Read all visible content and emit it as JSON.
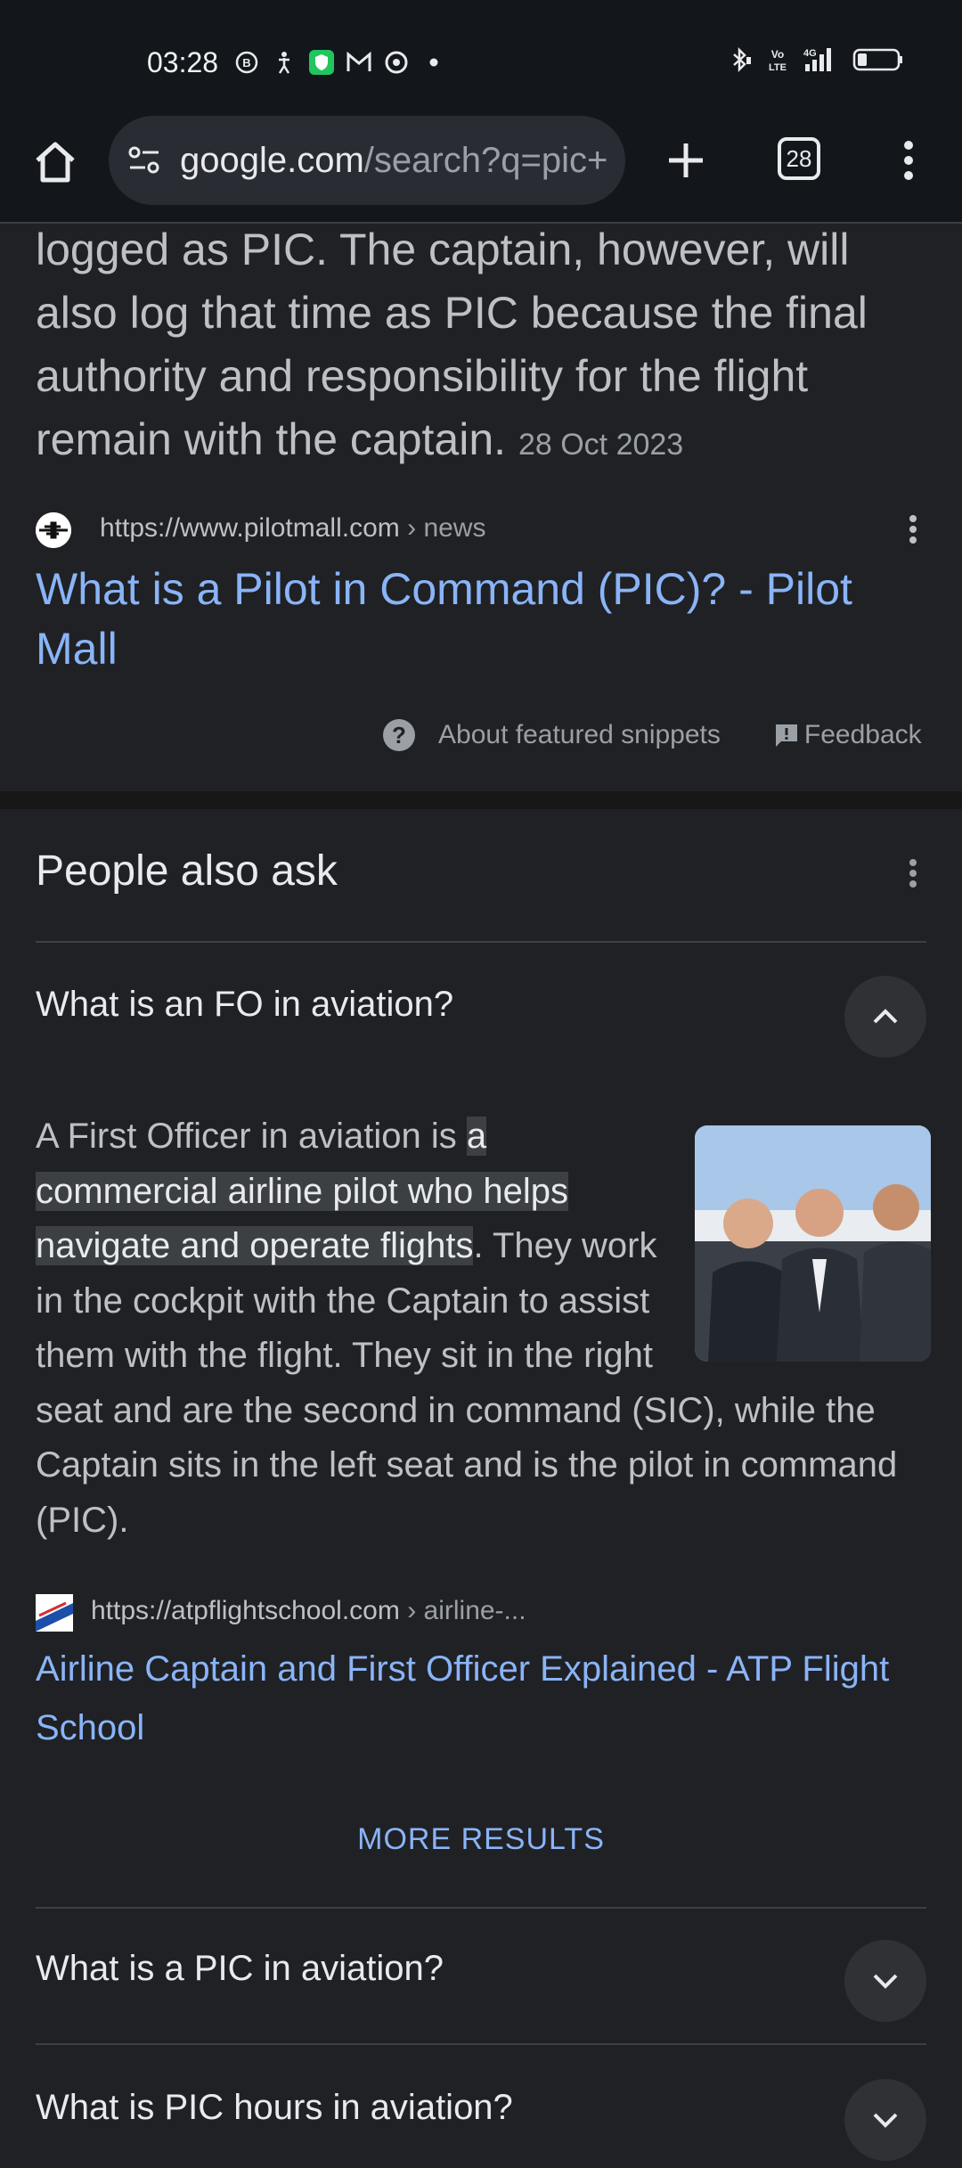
{
  "status_bar": {
    "time": "03:28",
    "left_icons": [
      "b-badge-icon",
      "runner-icon",
      "shield-app-icon",
      "gmail-icon",
      "chrome-icon",
      "dot-icon"
    ],
    "right_icons": [
      "bluetooth-icon",
      "volte-icon",
      "signal-4g-icon",
      "battery-icon"
    ],
    "volte_label": "Vo LTE",
    "network_label": "4G"
  },
  "toolbar": {
    "url_host": "google.com",
    "url_path": "/search?q=pic+",
    "tab_count": "28"
  },
  "snippet": {
    "text": "logged as PIC. The captain, however, will also log that time as PIC because the final authority and responsibility for the flight remain with the captain.",
    "date": "28 Oct 2023",
    "source_url": "https://www.pilotmall.com",
    "source_crumb": " › news",
    "link_title": "What is a Pilot in Command (PIC)? - Pilot Mall",
    "about_label": "About featured snippets",
    "feedback_label": "Feedback"
  },
  "people_also_ask": {
    "title": "People also ask",
    "questions": [
      {
        "text": "What is an FO in aviation?",
        "expanded": true
      },
      {
        "text": "What is a PIC in aviation?",
        "expanded": false
      },
      {
        "text": "What is PIC hours in aviation?",
        "expanded": false
      }
    ],
    "answer": {
      "before": "A First Officer in aviation is ",
      "highlight": "a commercial airline pilot who helps navigate and operate flights",
      "after": ". They work in the cockpit with the Captain to assist them with the flight. They sit in the right seat and are the second in command (SIC), while the Captain sits in the left seat and is the pilot in command (PIC).",
      "source_url": "https://atpflightschool.com",
      "source_crumb": " › airline-...",
      "link_title": "Airline Captain and First Officer Explained - ATP Flight School"
    },
    "more_results_label": "MORE RESULTS"
  },
  "colors": {
    "background": "#202124",
    "chrome_bar": "#13161b",
    "link": "#8ab4f8",
    "text_secondary": "#bdc1c6"
  }
}
